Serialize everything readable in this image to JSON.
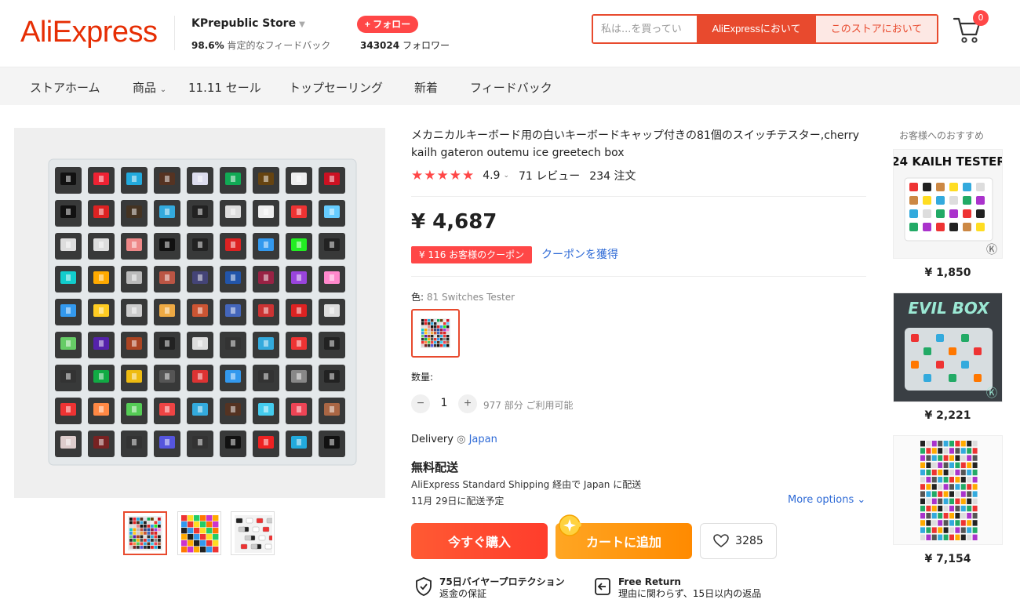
{
  "header": {
    "logo": "AliExpress",
    "store_name": "KPrepublic Store",
    "feedback_pct": "98.6%",
    "feedback_label": "肯定的なフィードバック",
    "follow_label": "+ フォロー",
    "followers_count": "343024",
    "followers_label": "フォロワー",
    "search_placeholder": "私は...を買ってい",
    "search_ae_label": "AliExpressにおいて",
    "search_store_label": "このストアにおいて",
    "cart_count": "0"
  },
  "nav": {
    "items": [
      "ストアホーム",
      "商品",
      "11.11 セール",
      "トップセーリング",
      "新着",
      "フィードバック"
    ]
  },
  "product": {
    "title": "メカニカルキーボード用の白いキーボードキャップ付きの81個のスイッチテスター,cherry kailh gateron outemu ice greetech box",
    "stars": "★★★★★",
    "rating": "4.9",
    "reviews": "71 レビュー",
    "orders": "234 注文",
    "price": "¥ 4,687",
    "coupon_tag": "¥ 116 お客様のクーポン",
    "coupon_link": "クーポンを獲得",
    "color_label": "色:",
    "color_value": "81 Switches Tester",
    "qty_label": "数量:",
    "qty_value": "1",
    "qty_avail": "977 部分 ご利用可能",
    "delivery_label": "Delivery",
    "delivery_loc": "Japan",
    "ship_free": "無料配送",
    "ship_method": "AliExpress Standard Shipping 経由で Japan に配送",
    "ship_date": "11月 29日に配送予定",
    "more_options": "More options",
    "buy_now": "今すぐ購入",
    "add_cart": "カートに追加",
    "wishlist_count": "3285",
    "guarantee1_title": "75日バイヤープロテクション",
    "guarantee1_sub": "返金の保証",
    "guarantee2_title": "Free Return",
    "guarantee2_sub": "理由に関わらず、15日以内の返品"
  },
  "recommend": {
    "title": "お客様へのおすすめ",
    "items": [
      {
        "label": "24 KAILH TESTER",
        "price": "¥ 1,850"
      },
      {
        "label": "EVIL BOX",
        "price": "¥ 2,221"
      },
      {
        "label": "",
        "price": "¥ 7,154"
      }
    ]
  },
  "colors": {
    "brand": "#e62e04",
    "accent": "#ff4747",
    "link": "#2e6ad6",
    "cart_button": "#ff9a00"
  }
}
